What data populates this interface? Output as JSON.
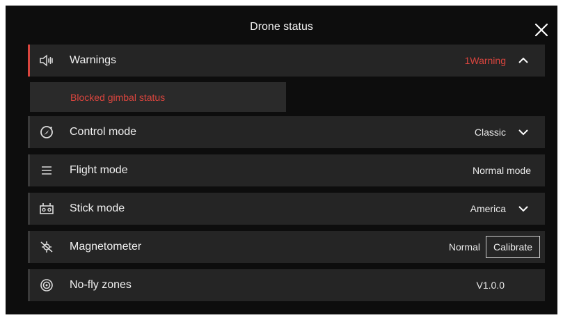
{
  "header": {
    "title": "Drone status"
  },
  "warnings": {
    "label": "Warnings",
    "count_text": "1Warning",
    "item": "Blocked gimbal status",
    "accent": "#d9453e"
  },
  "control_mode": {
    "label": "Control mode",
    "value": "Classic"
  },
  "flight_mode": {
    "label": "Flight mode",
    "value": "Normal mode"
  },
  "stick_mode": {
    "label": "Stick mode",
    "value": "America"
  },
  "magnetometer": {
    "label": "Magnetometer",
    "value": "Normal",
    "button": "Calibrate"
  },
  "no_fly_zones": {
    "label": "No-fly zones",
    "value": "V1.0.0"
  },
  "icons": {
    "close": "close-icon",
    "warnings": "speaker-icon",
    "control_mode": "compass-icon",
    "flight_mode": "list-icon",
    "stick_mode": "controller-icon",
    "magnetometer": "magnet-off-icon",
    "no_fly_zones": "target-icon"
  }
}
